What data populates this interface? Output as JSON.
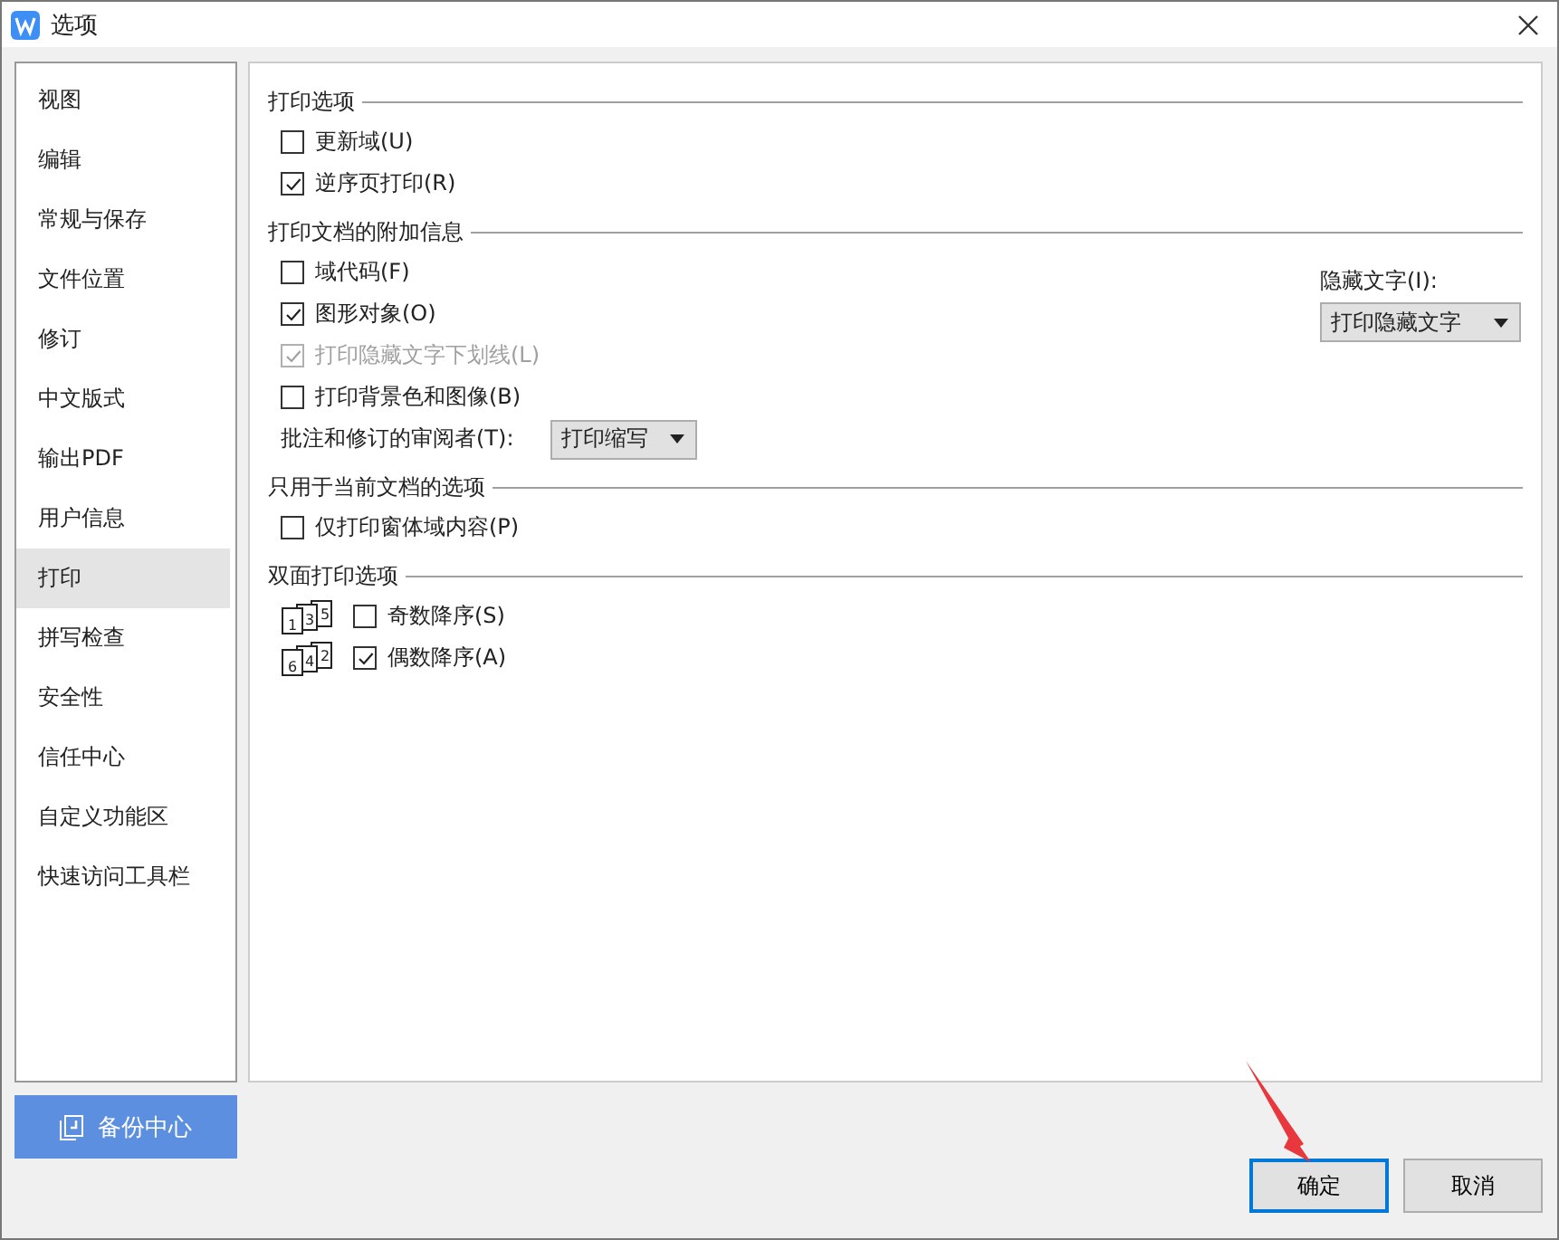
{
  "window": {
    "title": "选项"
  },
  "sidebar": {
    "items": [
      {
        "label": "视图",
        "selected": false
      },
      {
        "label": "编辑",
        "selected": false
      },
      {
        "label": "常规与保存",
        "selected": false
      },
      {
        "label": "文件位置",
        "selected": false
      },
      {
        "label": "修订",
        "selected": false
      },
      {
        "label": "中文版式",
        "selected": false
      },
      {
        "label": "输出PDF",
        "selected": false
      },
      {
        "label": "用户信息",
        "selected": false
      },
      {
        "label": "打印",
        "selected": true
      },
      {
        "label": "拼写检查",
        "selected": false
      },
      {
        "label": "安全性",
        "selected": false
      },
      {
        "label": "信任中心",
        "selected": false
      },
      {
        "label": "自定义功能区",
        "selected": false
      },
      {
        "label": "快速访问工具栏",
        "selected": false
      }
    ]
  },
  "sections": [
    {
      "title": "打印选项",
      "items": [
        {
          "kind": "checkbox",
          "label": "更新域(U)",
          "checked": false,
          "disabled": false
        },
        {
          "kind": "checkbox",
          "label": "逆序页打印(R)",
          "checked": true,
          "disabled": false
        }
      ]
    },
    {
      "title": "打印文档的附加信息",
      "items": [
        {
          "kind": "checkbox",
          "label": "域代码(F)",
          "checked": false,
          "disabled": false
        },
        {
          "kind": "checkbox",
          "label": "图形对象(O)",
          "checked": true,
          "disabled": false
        },
        {
          "kind": "checkbox",
          "label": "打印隐藏文字下划线(L)",
          "checked": true,
          "disabled": true
        },
        {
          "kind": "checkbox",
          "label": "打印背景色和图像(B)",
          "checked": false,
          "disabled": false
        },
        {
          "kind": "select",
          "label": "批注和修订的审阅者(T):",
          "value": "打印缩写"
        }
      ],
      "side": {
        "label": "隐藏文字(I):",
        "value": "打印隐藏文字"
      }
    },
    {
      "title": "只用于当前文档的选项",
      "items": [
        {
          "kind": "checkbox",
          "label": "仅打印窗体域内容(P)",
          "checked": false,
          "disabled": false
        }
      ]
    },
    {
      "title": "双面打印选项",
      "items": [
        {
          "kind": "duplex",
          "label": "奇数降序(S)",
          "checked": false,
          "pages": [
            "1",
            "3",
            "5"
          ]
        },
        {
          "kind": "duplex",
          "label": "偶数降序(A)",
          "checked": true,
          "pages": [
            "6",
            "4",
            "2"
          ]
        }
      ]
    }
  ],
  "backup_button": "备份中心",
  "buttons": [
    {
      "label": "确定",
      "selected": true
    },
    {
      "label": "取消",
      "selected": false
    }
  ]
}
